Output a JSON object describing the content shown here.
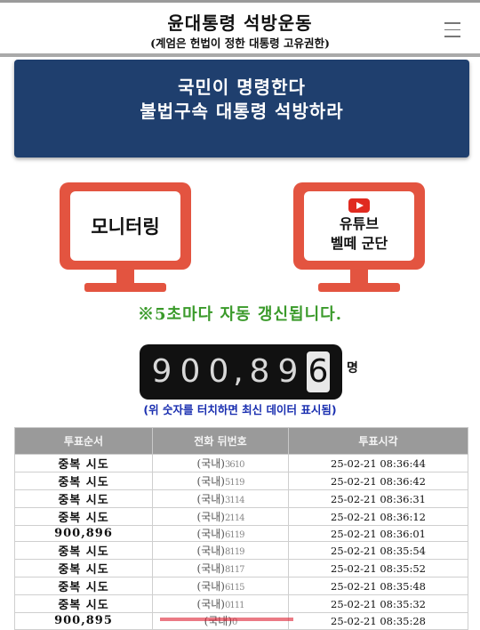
{
  "header": {
    "title": "윤대통령 석방운동",
    "subtitle": "(계엄은 헌법이 정한 대통령 고유권한)"
  },
  "banner": {
    "line1": "국민이 명령한다",
    "line2": "불법구속 대통령 석방하라"
  },
  "monitoring": {
    "label": "모니터링"
  },
  "youtube": {
    "line1": "유튜브",
    "line2": "벨떼 군단",
    "icon": "youtube-play-icon"
  },
  "auto_refresh": "※5초마다 자동 갱신됩니다.",
  "counter": {
    "d1": "9",
    "d2": "0",
    "d3": "0",
    "sep": ",",
    "d4": "8",
    "d5": "9",
    "d6": "6",
    "unit": "명"
  },
  "hint": "(위 숫자를 터치하면 최신 데이터 표시됨)",
  "table": {
    "headers": [
      "투표순서",
      "전화 뒤번호",
      "투표시각"
    ],
    "rows": [
      {
        "order": "중복 시도",
        "phone_prefix": "(국내)",
        "phone_mask": "3610",
        "time": "25-02-21 08:36:44"
      },
      {
        "order": "중복 시도",
        "phone_prefix": "(국내)",
        "phone_mask": "5119",
        "time": "25-02-21 08:36:42"
      },
      {
        "order": "중복 시도",
        "phone_prefix": "(국내)",
        "phone_mask": "3114",
        "time": "25-02-21 08:36:31"
      },
      {
        "order": "중복 시도",
        "phone_prefix": "(국내)",
        "phone_mask": "2114",
        "time": "25-02-21 08:36:12"
      },
      {
        "order": "900,896",
        "phone_prefix": "(국내)",
        "phone_mask": "6119",
        "time": "25-02-21 08:36:01"
      },
      {
        "order": "중복 시도",
        "phone_prefix": "(국내)",
        "phone_mask": "8119",
        "time": "25-02-21 08:35:54"
      },
      {
        "order": "중복 시도",
        "phone_prefix": "(국내)",
        "phone_mask": "8117",
        "time": "25-02-21 08:35:52"
      },
      {
        "order": "중복 시도",
        "phone_prefix": "(국내)",
        "phone_mask": "6115",
        "time": "25-02-21 08:35:48"
      },
      {
        "order": "중복 시도",
        "phone_prefix": "(국내)",
        "phone_mask": "0111",
        "time": "25-02-21 08:35:32"
      },
      {
        "order": "900,895",
        "phone_prefix": "(국내)",
        "phone_mask": "0",
        "time": "25-02-21 08:35:28"
      }
    ]
  },
  "colors": {
    "banner_bg": "#1f3f6e",
    "monitor_red": "#e35440",
    "refresh_green": "#3a9a2a",
    "hint_blue": "#1a2fb0",
    "table_header": "#9a9a9a"
  }
}
